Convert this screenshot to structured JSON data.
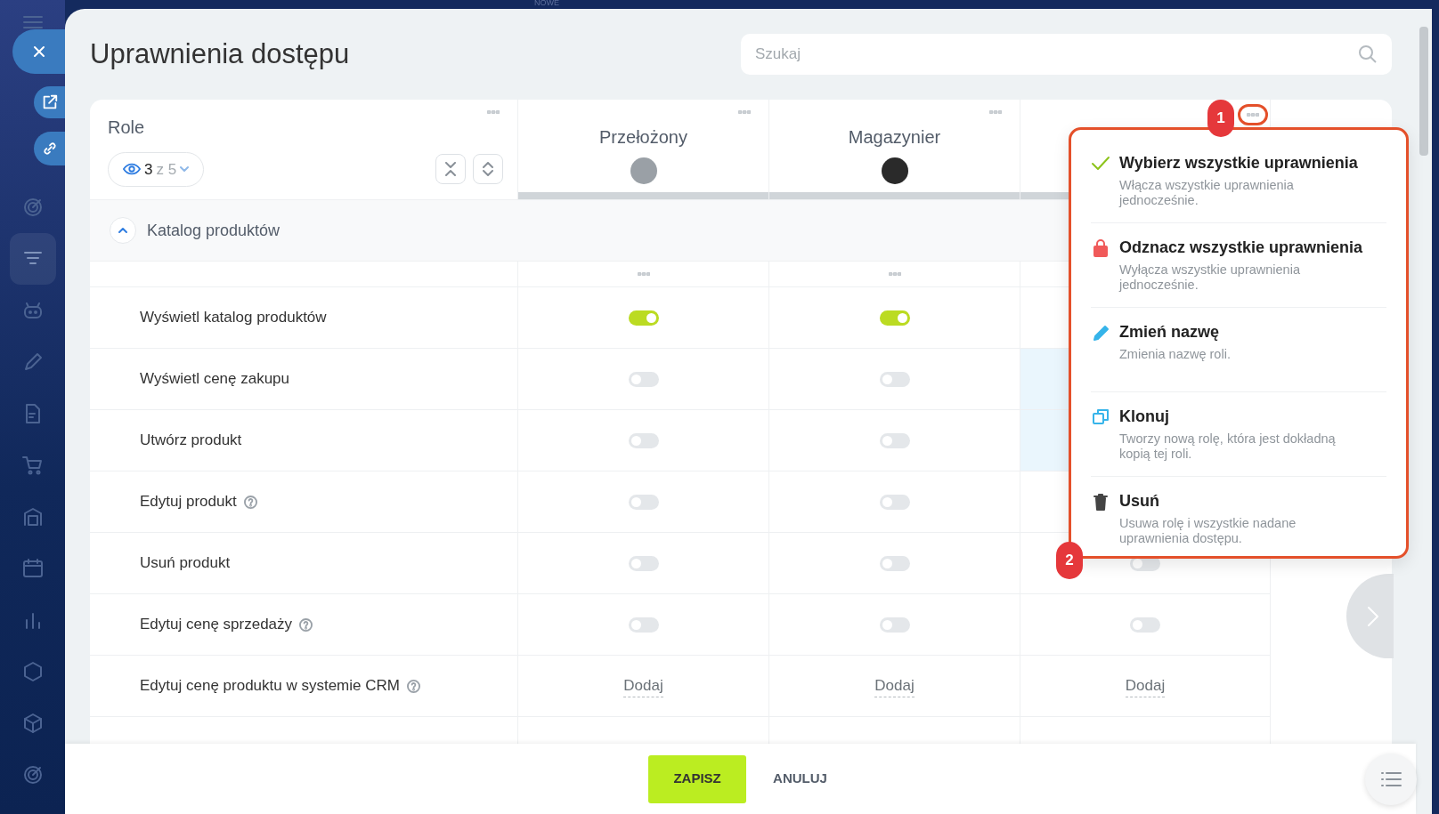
{
  "top_bar": {
    "label": "NOWE"
  },
  "sidebar": {
    "items": [
      {
        "selected": false
      },
      {
        "selected": true
      },
      {
        "selected": false
      },
      {
        "selected": false
      },
      {
        "selected": false
      },
      {
        "selected": false
      },
      {
        "selected": false
      },
      {
        "selected": false
      },
      {
        "selected": false
      },
      {
        "selected": false
      },
      {
        "selected": false
      },
      {
        "selected": false
      }
    ]
  },
  "title": "Uprawnienia dostępu",
  "search": {
    "placeholder": "Szukaj"
  },
  "roles_header": {
    "label": "Role",
    "shown": "3",
    "total": "z 5"
  },
  "roles": [
    {
      "name": "Przełożony",
      "avatar": true
    },
    {
      "name": "Magazynier",
      "avatar": true
    },
    {
      "avatar": false
    }
  ],
  "section": {
    "title": "Katalog produktów",
    "expanded": true
  },
  "rows": [
    {
      "label": "Wyświetl katalog produktów",
      "help": false,
      "cells": [
        {
          "kind": "toggle",
          "on": true
        },
        {
          "kind": "toggle",
          "on": true
        },
        {
          "kind": "hidden"
        }
      ]
    },
    {
      "label": "Wyświetl cenę zakupu",
      "help": false,
      "cells": [
        {
          "kind": "toggle",
          "on": false
        },
        {
          "kind": "toggle",
          "on": false
        },
        {
          "kind": "hidden",
          "highlighted": true
        }
      ]
    },
    {
      "label": "Utwórz produkt",
      "help": false,
      "cells": [
        {
          "kind": "toggle",
          "on": false
        },
        {
          "kind": "toggle",
          "on": false
        },
        {
          "kind": "hidden",
          "highlighted": true
        }
      ]
    },
    {
      "label": "Edytuj produkt",
      "help": true,
      "cells": [
        {
          "kind": "toggle",
          "on": false
        },
        {
          "kind": "toggle",
          "on": false
        },
        {
          "kind": "hidden"
        }
      ]
    },
    {
      "label": "Usuń produkt",
      "help": false,
      "cells": [
        {
          "kind": "toggle",
          "on": false
        },
        {
          "kind": "toggle",
          "on": false
        },
        {
          "kind": "toggle",
          "on": false
        }
      ]
    },
    {
      "label": "Edytuj cenę sprzedaży",
      "help": true,
      "cells": [
        {
          "kind": "toggle",
          "on": false
        },
        {
          "kind": "toggle",
          "on": false
        },
        {
          "kind": "toggle",
          "on": false
        }
      ]
    },
    {
      "label": "Edytuj cenę produktu w systemie CRM",
      "help": true,
      "cells": [
        {
          "kind": "link",
          "text": "Dodaj"
        },
        {
          "kind": "link",
          "text": "Dodaj"
        },
        {
          "kind": "link",
          "text": "Dodaj"
        }
      ]
    }
  ],
  "menu": {
    "items": [
      {
        "kind": "select",
        "title": "Wybierz wszystkie uprawnienia",
        "description": "Włącza wszystkie uprawnienia jednocześnie."
      },
      {
        "kind": "deselect",
        "title": "Odznacz wszystkie uprawnienia",
        "description": "Wyłącza wszystkie uprawnienia jednocześnie."
      },
      {
        "kind": "rename",
        "title": "Zmień nazwę",
        "description": "Zmienia nazwę roli."
      },
      {
        "kind": "clone",
        "title": "Klonuj",
        "description": "Tworzy nową rolę, która jest dokładną kopią tej roli."
      },
      {
        "kind": "delete",
        "title": "Usuń",
        "description": "Usuwa rolę i wszystkie nadane uprawnienia dostępu."
      }
    ]
  },
  "annotations": [
    {
      "label": "1"
    },
    {
      "label": "2"
    }
  ],
  "footer": {
    "save": "ZAPISZ",
    "cancel": "ANULUJ"
  }
}
